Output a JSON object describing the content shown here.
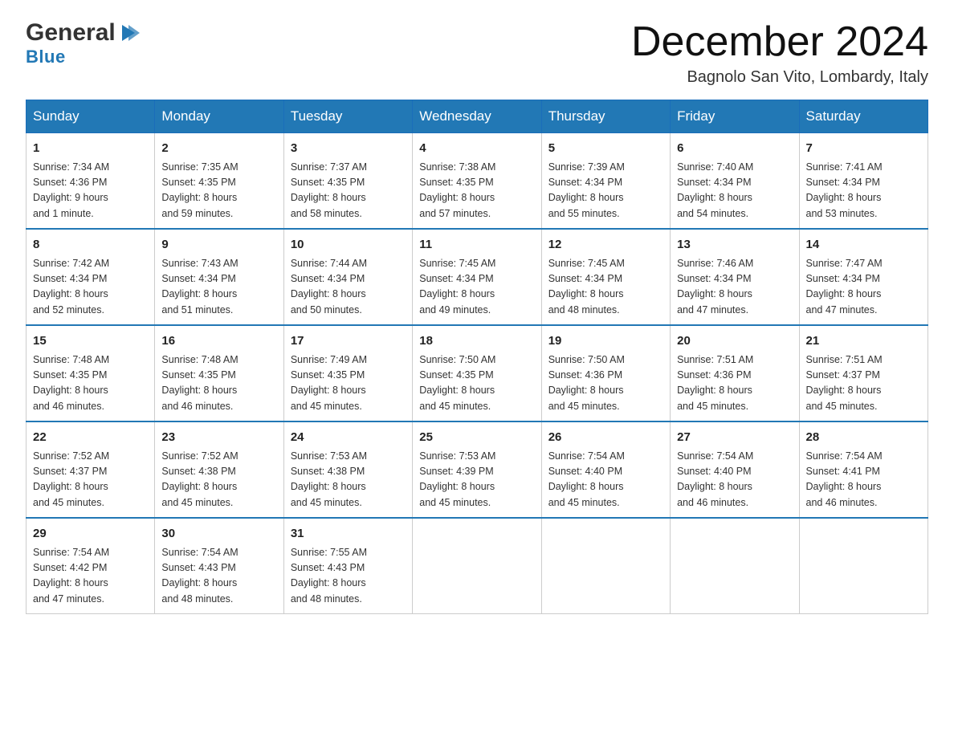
{
  "header": {
    "logo_name": "General",
    "logo_accent": "Blue",
    "month_title": "December 2024",
    "location": "Bagnolo San Vito, Lombardy, Italy"
  },
  "columns": [
    "Sunday",
    "Monday",
    "Tuesday",
    "Wednesday",
    "Thursday",
    "Friday",
    "Saturday"
  ],
  "weeks": [
    [
      {
        "num": "1",
        "sunrise": "7:34 AM",
        "sunset": "4:36 PM",
        "daylight": "9 hours and 1 minute."
      },
      {
        "num": "2",
        "sunrise": "7:35 AM",
        "sunset": "4:35 PM",
        "daylight": "8 hours and 59 minutes."
      },
      {
        "num": "3",
        "sunrise": "7:37 AM",
        "sunset": "4:35 PM",
        "daylight": "8 hours and 58 minutes."
      },
      {
        "num": "4",
        "sunrise": "7:38 AM",
        "sunset": "4:35 PM",
        "daylight": "8 hours and 57 minutes."
      },
      {
        "num": "5",
        "sunrise": "7:39 AM",
        "sunset": "4:34 PM",
        "daylight": "8 hours and 55 minutes."
      },
      {
        "num": "6",
        "sunrise": "7:40 AM",
        "sunset": "4:34 PM",
        "daylight": "8 hours and 54 minutes."
      },
      {
        "num": "7",
        "sunrise": "7:41 AM",
        "sunset": "4:34 PM",
        "daylight": "8 hours and 53 minutes."
      }
    ],
    [
      {
        "num": "8",
        "sunrise": "7:42 AM",
        "sunset": "4:34 PM",
        "daylight": "8 hours and 52 minutes."
      },
      {
        "num": "9",
        "sunrise": "7:43 AM",
        "sunset": "4:34 PM",
        "daylight": "8 hours and 51 minutes."
      },
      {
        "num": "10",
        "sunrise": "7:44 AM",
        "sunset": "4:34 PM",
        "daylight": "8 hours and 50 minutes."
      },
      {
        "num": "11",
        "sunrise": "7:45 AM",
        "sunset": "4:34 PM",
        "daylight": "8 hours and 49 minutes."
      },
      {
        "num": "12",
        "sunrise": "7:45 AM",
        "sunset": "4:34 PM",
        "daylight": "8 hours and 48 minutes."
      },
      {
        "num": "13",
        "sunrise": "7:46 AM",
        "sunset": "4:34 PM",
        "daylight": "8 hours and 47 minutes."
      },
      {
        "num": "14",
        "sunrise": "7:47 AM",
        "sunset": "4:34 PM",
        "daylight": "8 hours and 47 minutes."
      }
    ],
    [
      {
        "num": "15",
        "sunrise": "7:48 AM",
        "sunset": "4:35 PM",
        "daylight": "8 hours and 46 minutes."
      },
      {
        "num": "16",
        "sunrise": "7:48 AM",
        "sunset": "4:35 PM",
        "daylight": "8 hours and 46 minutes."
      },
      {
        "num": "17",
        "sunrise": "7:49 AM",
        "sunset": "4:35 PM",
        "daylight": "8 hours and 45 minutes."
      },
      {
        "num": "18",
        "sunrise": "7:50 AM",
        "sunset": "4:35 PM",
        "daylight": "8 hours and 45 minutes."
      },
      {
        "num": "19",
        "sunrise": "7:50 AM",
        "sunset": "4:36 PM",
        "daylight": "8 hours and 45 minutes."
      },
      {
        "num": "20",
        "sunrise": "7:51 AM",
        "sunset": "4:36 PM",
        "daylight": "8 hours and 45 minutes."
      },
      {
        "num": "21",
        "sunrise": "7:51 AM",
        "sunset": "4:37 PM",
        "daylight": "8 hours and 45 minutes."
      }
    ],
    [
      {
        "num": "22",
        "sunrise": "7:52 AM",
        "sunset": "4:37 PM",
        "daylight": "8 hours and 45 minutes."
      },
      {
        "num": "23",
        "sunrise": "7:52 AM",
        "sunset": "4:38 PM",
        "daylight": "8 hours and 45 minutes."
      },
      {
        "num": "24",
        "sunrise": "7:53 AM",
        "sunset": "4:38 PM",
        "daylight": "8 hours and 45 minutes."
      },
      {
        "num": "25",
        "sunrise": "7:53 AM",
        "sunset": "4:39 PM",
        "daylight": "8 hours and 45 minutes."
      },
      {
        "num": "26",
        "sunrise": "7:54 AM",
        "sunset": "4:40 PM",
        "daylight": "8 hours and 45 minutes."
      },
      {
        "num": "27",
        "sunrise": "7:54 AM",
        "sunset": "4:40 PM",
        "daylight": "8 hours and 46 minutes."
      },
      {
        "num": "28",
        "sunrise": "7:54 AM",
        "sunset": "4:41 PM",
        "daylight": "8 hours and 46 minutes."
      }
    ],
    [
      {
        "num": "29",
        "sunrise": "7:54 AM",
        "sunset": "4:42 PM",
        "daylight": "8 hours and 47 minutes."
      },
      {
        "num": "30",
        "sunrise": "7:54 AM",
        "sunset": "4:43 PM",
        "daylight": "8 hours and 48 minutes."
      },
      {
        "num": "31",
        "sunrise": "7:55 AM",
        "sunset": "4:43 PM",
        "daylight": "8 hours and 48 minutes."
      },
      null,
      null,
      null,
      null
    ]
  ],
  "labels": {
    "sunrise": "Sunrise:",
    "sunset": "Sunset:",
    "daylight": "Daylight:"
  }
}
